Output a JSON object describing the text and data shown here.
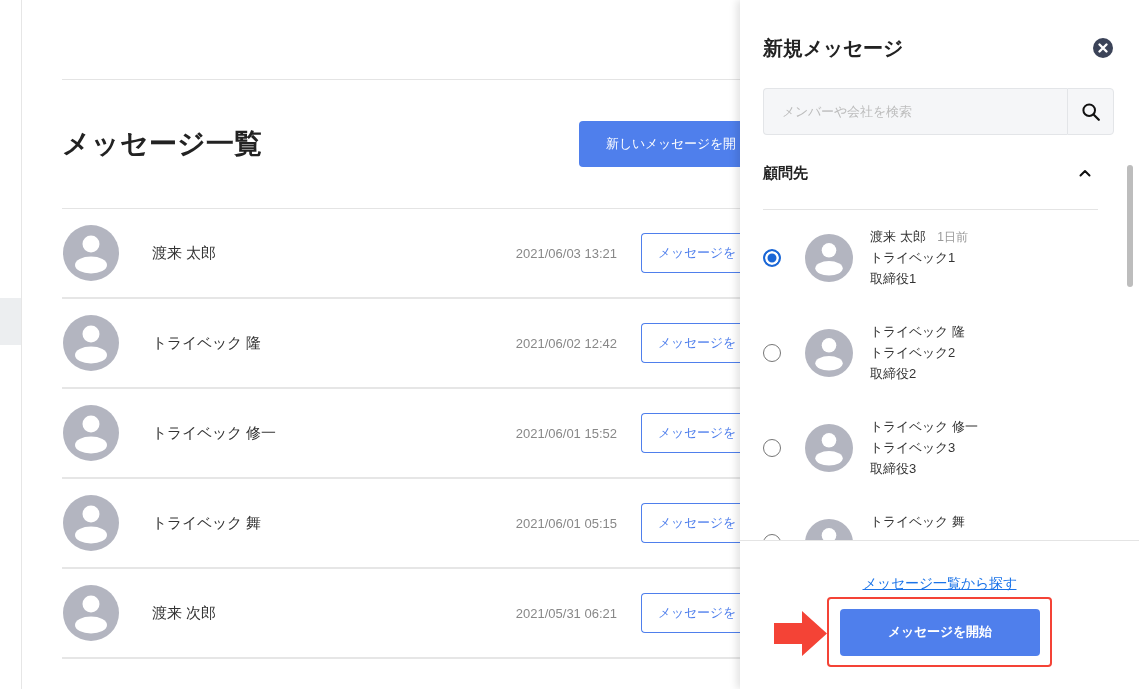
{
  "main": {
    "title": "メッセージ一覧",
    "new_message_button": "新しいメッセージを開"
  },
  "conversations": [
    {
      "name": "渡来 太郎",
      "datetime": "2021/06/03 13:21",
      "button": "メッセージを"
    },
    {
      "name": "トライベック 隆",
      "datetime": "2021/06/02 12:42",
      "button": "メッセージを"
    },
    {
      "name": "トライベック 修一",
      "datetime": "2021/06/01 15:52",
      "button": "メッセージを"
    },
    {
      "name": "トライベック 舞",
      "datetime": "2021/06/01 05:15",
      "button": "メッセージを"
    },
    {
      "name": "渡来 次郎",
      "datetime": "2021/05/31 06:21",
      "button": "メッセージを"
    }
  ],
  "panel": {
    "title": "新規メッセージ",
    "search": {
      "placeholder": "メンバーや会社を検索"
    },
    "section": {
      "title": "顧問先",
      "expanded": true
    },
    "members": [
      {
        "name": "渡来 太郎",
        "time": "1日前",
        "company": "トライベック1",
        "role": "取締役1",
        "selected": true
      },
      {
        "name": "トライベック 隆",
        "company": "トライベック2",
        "role": "取締役2",
        "selected": false
      },
      {
        "name": "トライベック 修一",
        "company": "トライベック3",
        "role": "取締役3",
        "selected": false
      },
      {
        "name": "トライベック 舞",
        "selected": false
      }
    ],
    "link": "メッセージ一覧から探す",
    "start_button": "メッセージを開始"
  }
}
